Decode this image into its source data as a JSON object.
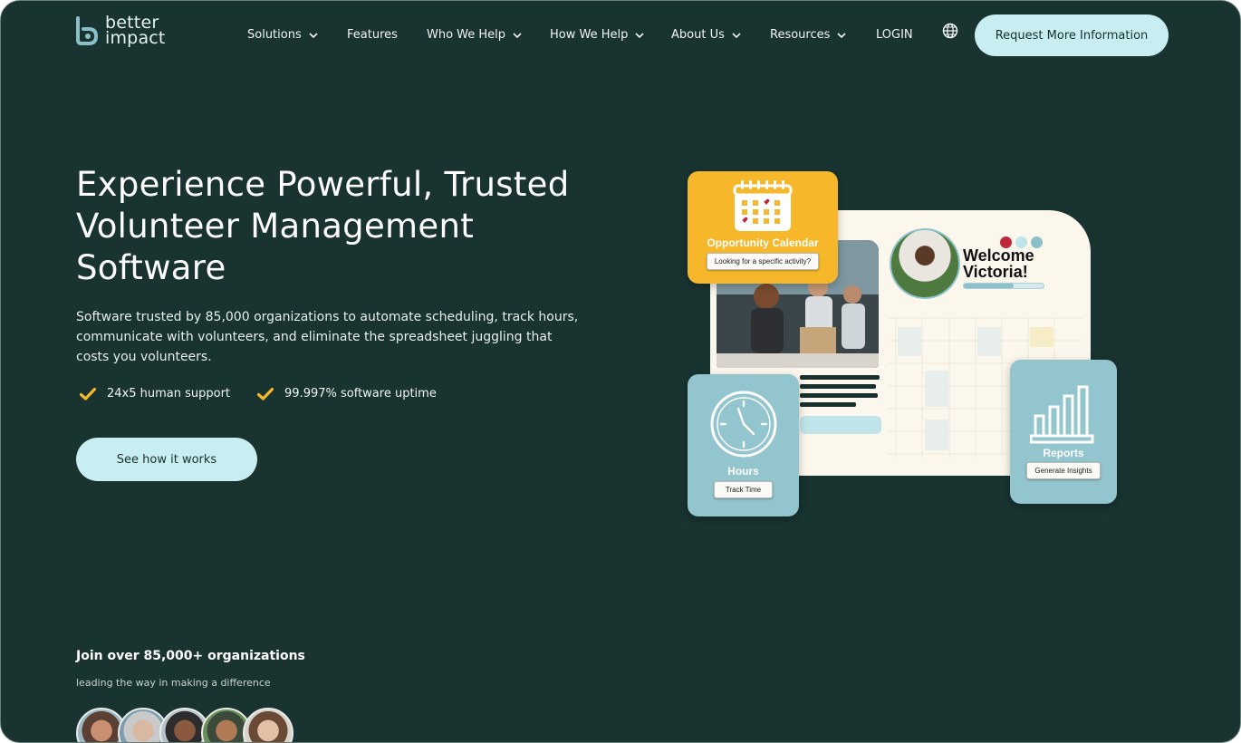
{
  "brand": {
    "line1": "better",
    "line2": "impact",
    "color": "#8cc0c9"
  },
  "nav": {
    "items": [
      {
        "label": "Solutions",
        "dropdown": true
      },
      {
        "label": "Features",
        "dropdown": false
      },
      {
        "label": "Who We Help",
        "dropdown": true
      },
      {
        "label": "How We Help",
        "dropdown": true
      },
      {
        "label": "About Us",
        "dropdown": true
      },
      {
        "label": "Resources",
        "dropdown": true
      },
      {
        "label": "LOGIN",
        "dropdown": false
      }
    ],
    "globe_icon": "globe-icon",
    "cta_label": "Request More Information"
  },
  "hero": {
    "title": "Experience Powerful, Trusted Volunteer Management Software",
    "subtitle": "Software trusted by 85,000 organizations to automate scheduling, track hours, communicate with volunteers, and eliminate the spreadsheet juggling that costs you volunteers.",
    "checks": [
      {
        "label": "24x5 human support",
        "icon": "check-icon"
      },
      {
        "label": "99.997% software uptime",
        "icon": "check-icon"
      }
    ],
    "button_label": "See how it works"
  },
  "illustration": {
    "calendar_card": {
      "title": "Opportunity Calendar",
      "button": "Looking for a specific activity?"
    },
    "welcome": {
      "line1": "Welcome",
      "line2": "Victoria!"
    },
    "hours_card": {
      "title": "Hours",
      "button": "Track Time"
    },
    "reports_card": {
      "title": "Reports",
      "button": "Generate Insights"
    },
    "colors": {
      "yellow": "#f6b82a",
      "teal": "#92c5cd",
      "cream": "#fbf7ec",
      "red": "#c0293a"
    }
  },
  "social": {
    "heading": "Join over 85,000+ organizations",
    "subheading": "leading the way in making a difference"
  },
  "colors": {
    "background": "#183330",
    "button": "#c9eef1",
    "check": "#f6b82a",
    "text": "#ffffff"
  }
}
